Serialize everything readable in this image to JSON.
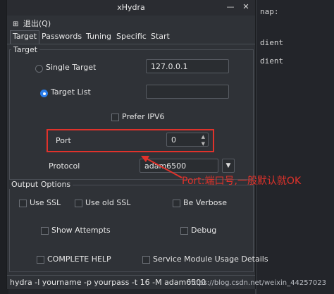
{
  "window": {
    "title": "xHydra",
    "menu": [
      {
        "label": "退出(Q)",
        "icon": "exit-icon"
      }
    ],
    "tabs": [
      "Target",
      "Passwords",
      "Tuning",
      "Specific",
      "Start"
    ],
    "active_tab": "Target"
  },
  "target_group": {
    "title": "Target",
    "single_target_label": "Single Target",
    "single_target_value": "127.0.0.1",
    "target_list_label": "Target List",
    "target_list_value": "",
    "selected_mode": "Target List",
    "prefer_ipv6_label": "Prefer IPV6",
    "port_label": "Port",
    "port_value": "0",
    "protocol_label": "Protocol",
    "protocol_value": "adam6500"
  },
  "output_group": {
    "title": "Output Options",
    "use_ssl": "Use SSL",
    "use_old_ssl": "Use old SSL",
    "be_verbose": "Be Verbose",
    "show_attempts": "Show Attempts",
    "debug": "Debug",
    "complete_help": "COMPLETE HELP",
    "service_usage": "Service Module Usage Details"
  },
  "command_line": "hydra -l yourname -p yourpass -t 16 -M  adam6500",
  "annotation": {
    "text": "Port:端口号,一般默认就OK",
    "color": "#e0322b"
  },
  "background_terminal": {
    "lines": [
      "nap:",
      "dient",
      "dient"
    ]
  },
  "watermark": "https://blog.csdn.net/weixin_44257023"
}
